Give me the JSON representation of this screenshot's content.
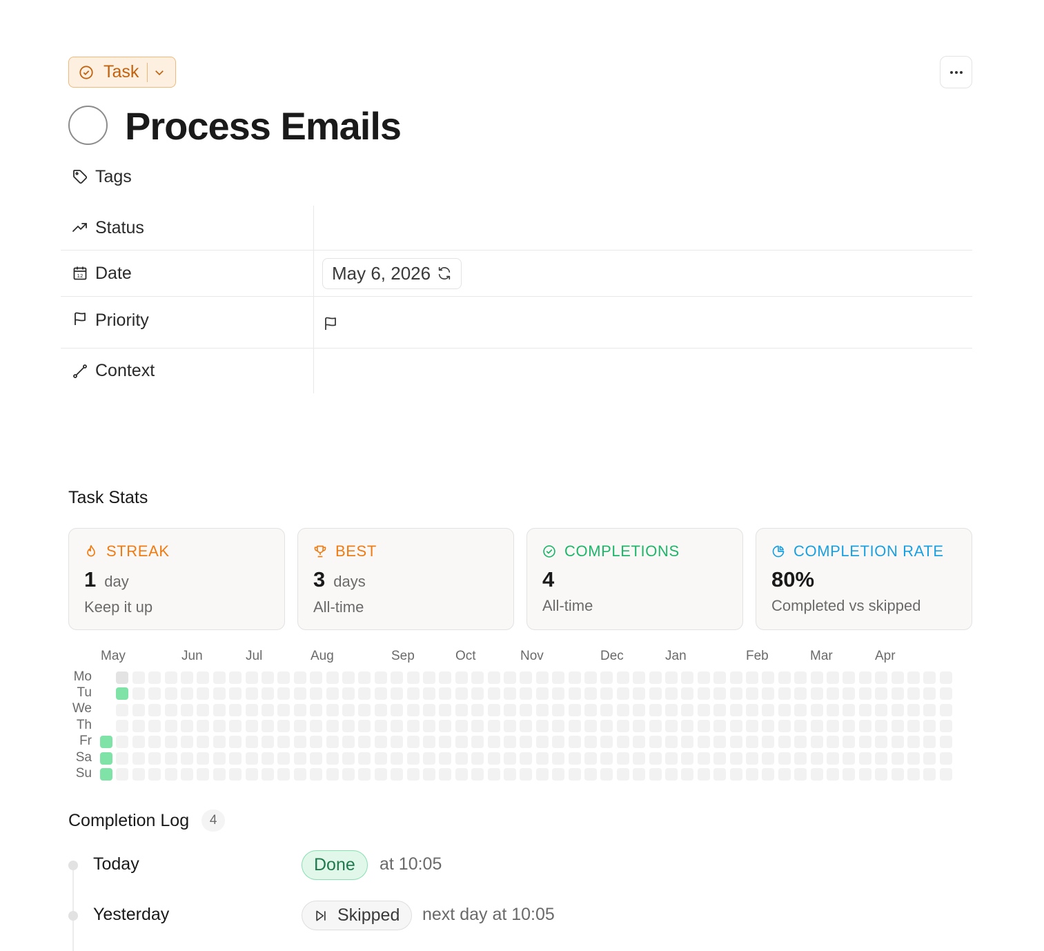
{
  "header": {
    "type_label": "Task",
    "title": "Process Emails",
    "more_glyph": "···"
  },
  "tags": {
    "label": "Tags"
  },
  "properties": [
    {
      "key": "status",
      "label": "Status",
      "icon": "trending-up-icon",
      "value": ""
    },
    {
      "key": "date",
      "label": "Date",
      "icon": "calendar-icon",
      "value": "May 6, 2026"
    },
    {
      "key": "priority",
      "label": "Priority",
      "icon": "flag-icon",
      "value": ""
    },
    {
      "key": "context",
      "label": "Context",
      "icon": "route-icon",
      "value": ""
    }
  ],
  "stats": {
    "section_title": "Task Stats",
    "cards": [
      {
        "label": "STREAK",
        "value": "1",
        "unit": "day",
        "sub": "Keep it up",
        "color": "#f07b12"
      },
      {
        "label": "BEST",
        "value": "3",
        "unit": "days",
        "sub": "All-time",
        "color": "#f07b12"
      },
      {
        "label": "COMPLETIONS",
        "value": "4",
        "unit": "",
        "sub": "All-time",
        "color": "#1fb56a"
      },
      {
        "label": "COMPLETION RATE",
        "value": "80%",
        "unit": "",
        "sub": "Completed vs skipped",
        "color": "#1a9fe0"
      }
    ]
  },
  "heatmap": {
    "months": [
      "May",
      "Jun",
      "Jul",
      "Aug",
      "Sep",
      "Oct",
      "Nov",
      "Dec",
      "Jan",
      "Feb",
      "Mar",
      "Apr"
    ],
    "days": [
      "Mo",
      "Tu",
      "We",
      "Th",
      "Fr",
      "Sa",
      "Su"
    ],
    "weeks": 53,
    "filled": [
      [
        0,
        4
      ],
      [
        0,
        5
      ],
      [
        0,
        6
      ],
      [
        1,
        1
      ]
    ],
    "today": [
      1,
      0
    ],
    "empty_leading": [
      [
        0,
        0
      ],
      [
        0,
        1
      ],
      [
        0,
        2
      ],
      [
        0,
        3
      ]
    ],
    "colors": {
      "done": "#7fe3a8",
      "today": "#e3e3e3",
      "empty": "#f2f2f2"
    }
  },
  "log": {
    "title": "Completion Log",
    "count": "4",
    "entries": [
      {
        "when": "Today",
        "status": "Done",
        "detail": "at 10:05"
      },
      {
        "when": "Yesterday",
        "status": "Skipped",
        "detail": "next day at 10:05"
      }
    ]
  }
}
